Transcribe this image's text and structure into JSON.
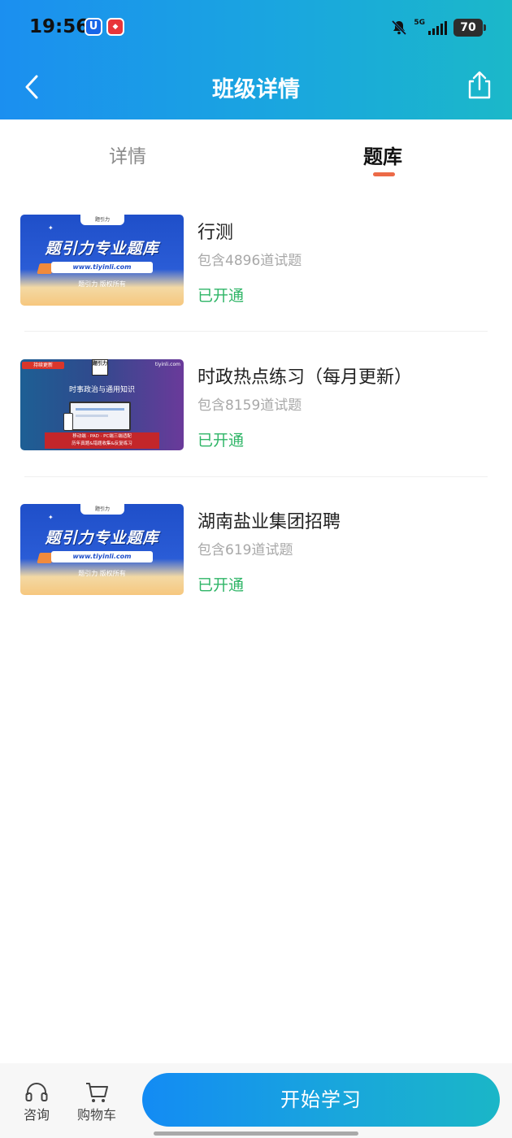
{
  "status_bar": {
    "time": "19:56",
    "network": "5G",
    "battery": "70"
  },
  "header": {
    "title": "班级详情"
  },
  "tabs": [
    {
      "label": "详情",
      "active": false
    },
    {
      "label": "题库",
      "active": true
    }
  ],
  "courses": [
    {
      "name": "行测",
      "count": "包含4896道试题",
      "status": "已开通",
      "thumb": {
        "title": "题引力专业题库",
        "url": "www.tiyinli.com",
        "copyright": "题引力 版权所有",
        "brand": "题引力"
      }
    },
    {
      "name": "时政热点练习（每月更新）",
      "count": "包含8159道试题",
      "status": "已开通",
      "thumb": {
        "tag": "持续更新",
        "logo": "题引力",
        "url": "tiyinli.com",
        "title": "时事政治与通用知识",
        "band_line1": "移动端 · PAD · PC端三端适配",
        "band_line2": "历年真题&错题收集&反复练习"
      }
    },
    {
      "name": "湖南盐业集团招聘",
      "count": "包含619道试题",
      "status": "已开通",
      "thumb": {
        "title": "题引力专业题库",
        "url": "www.tiyinli.com",
        "copyright": "题引力 版权所有",
        "brand": "题引力"
      }
    }
  ],
  "bottom_bar": {
    "consult_label": "咨询",
    "cart_label": "购物车",
    "start_label": "开始学习"
  },
  "colors": {
    "header_start": "#1b8ff0",
    "header_end": "#1bb8c9",
    "status_open": "#2fb567",
    "tab_indicator": "#ec6a47"
  }
}
